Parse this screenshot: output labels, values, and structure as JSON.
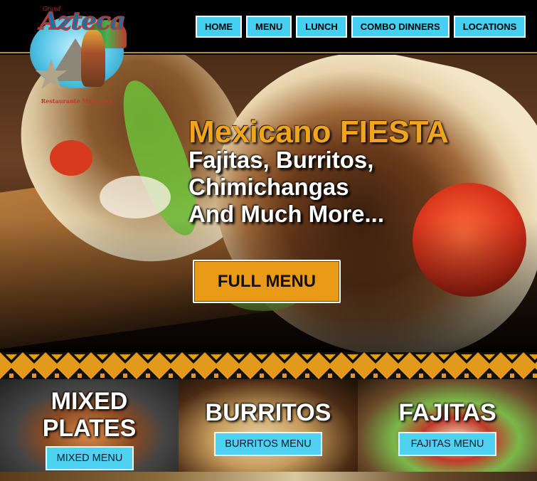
{
  "logo": {
    "grand": "Grand",
    "name": "Azteca",
    "subtitle": "Restaurante Mexicano"
  },
  "nav": {
    "items": [
      "HOME",
      "MENU",
      "LUNCH",
      "COMBO DINNERS",
      "LOCATIONS"
    ]
  },
  "hero": {
    "title": "Mexicano FIESTA",
    "line1": "Fajitas, Burritos,",
    "line2": "Chimichangas",
    "line3": "And Much More...",
    "button": "FULL MENU"
  },
  "cards": [
    {
      "title_line1": "MIXED",
      "title_line2": "PLATES",
      "button": "MIXED MENU"
    },
    {
      "title_line1": "BURRITOS",
      "button": "BURRITOS MENU"
    },
    {
      "title_line1": "FAJITAS",
      "button": "FAJITAS MENU"
    }
  ],
  "colors": {
    "nav_button": "#45d0f2",
    "accent_orange": "#e99a17",
    "hero_title": "#f0a51e",
    "card_button": "#4fd2f2"
  }
}
